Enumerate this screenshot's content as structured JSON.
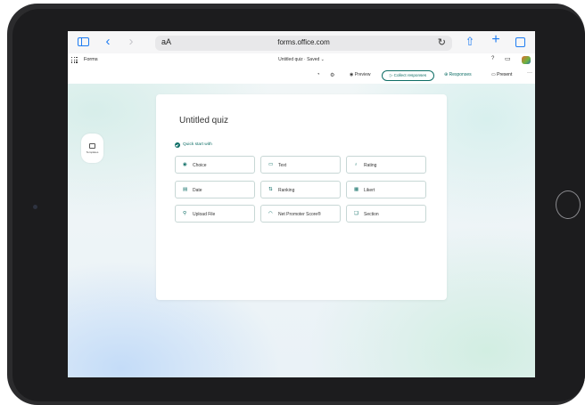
{
  "browser": {
    "text_size_label": "aA",
    "url": "forms.office.com",
    "back_glyph": "‹",
    "forward_glyph": "›",
    "reload_glyph": "↻",
    "share_glyph": "⇧",
    "new_tab_glyph": "+"
  },
  "forms_header": {
    "app_name": "Forms",
    "document_title": "Untitled quiz · Saved ⌄",
    "help_glyph": "?",
    "chat_glyph": "▭"
  },
  "toolbar": {
    "icon_a": "◔",
    "icon_b": "⚙",
    "preview_label": "◉ Preview",
    "collect_label": "▷ Collect responses",
    "responses_label": "⊕ Responses",
    "present_label": "▭ Present",
    "more_glyph": "···"
  },
  "templates": {
    "label": "Templates"
  },
  "card": {
    "title": "Untitled quiz",
    "quick_start_label": "Quick start with",
    "options": [
      {
        "label": "Choice",
        "icon": "choice-radio-icon",
        "glyph": "◉"
      },
      {
        "label": "Text",
        "icon": "text-box-icon",
        "glyph": "▭"
      },
      {
        "label": "Rating",
        "icon": "rating-hand-icon",
        "glyph": "♁"
      },
      {
        "label": "Date",
        "icon": "calendar-icon",
        "glyph": "▤"
      },
      {
        "label": "Ranking",
        "icon": "ranking-arrows-icon",
        "glyph": "⇅"
      },
      {
        "label": "Likert",
        "icon": "likert-grid-icon",
        "glyph": "▦"
      },
      {
        "label": "Upload File",
        "icon": "upload-pin-icon",
        "glyph": "⚲"
      },
      {
        "label": "Net Promoter Score®",
        "icon": "gauge-icon",
        "glyph": "◠"
      },
      {
        "label": "Section",
        "icon": "section-icon",
        "glyph": "❏"
      }
    ]
  },
  "colors": {
    "accent": "#0f6e66",
    "safari_blue": "#1e7cf2",
    "device_bezel": "#2b2b2d"
  }
}
